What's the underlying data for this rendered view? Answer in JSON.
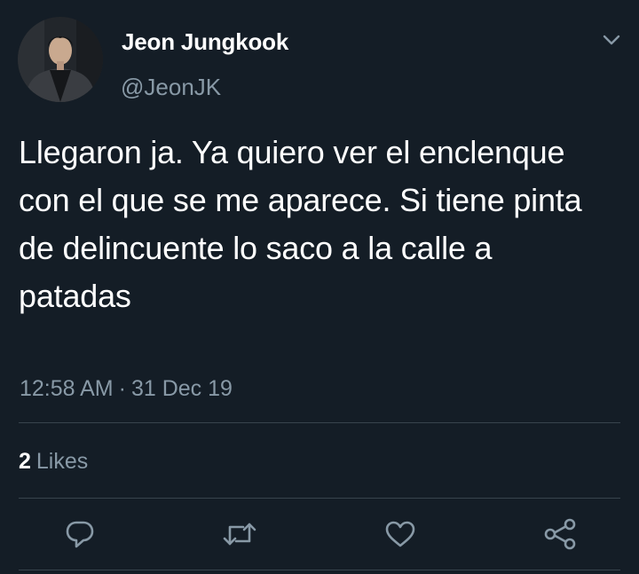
{
  "author": {
    "display_name": "Jeon Jungkook",
    "handle": "@JeonJK",
    "avatar_icon": "profile-photo"
  },
  "tweet": {
    "text": "Llegaron ja. Ya quiero ver el enclenque con el que se me aparece. Si tiene pinta de delincuente lo saco a la calle a patadas",
    "time": "12:58 AM",
    "separator": "·",
    "date": "31 Dec 19"
  },
  "stats": {
    "likes_count": "2",
    "likes_label": "Likes"
  },
  "actions": [
    {
      "name": "reply",
      "icon": "reply-icon"
    },
    {
      "name": "retweet",
      "icon": "retweet-icon"
    },
    {
      "name": "like",
      "icon": "heart-icon"
    },
    {
      "name": "share",
      "icon": "share-icon"
    }
  ],
  "colors": {
    "background": "#141d26",
    "text_primary": "#ffffff",
    "text_secondary": "#8899a6",
    "divider": "#38444d"
  }
}
